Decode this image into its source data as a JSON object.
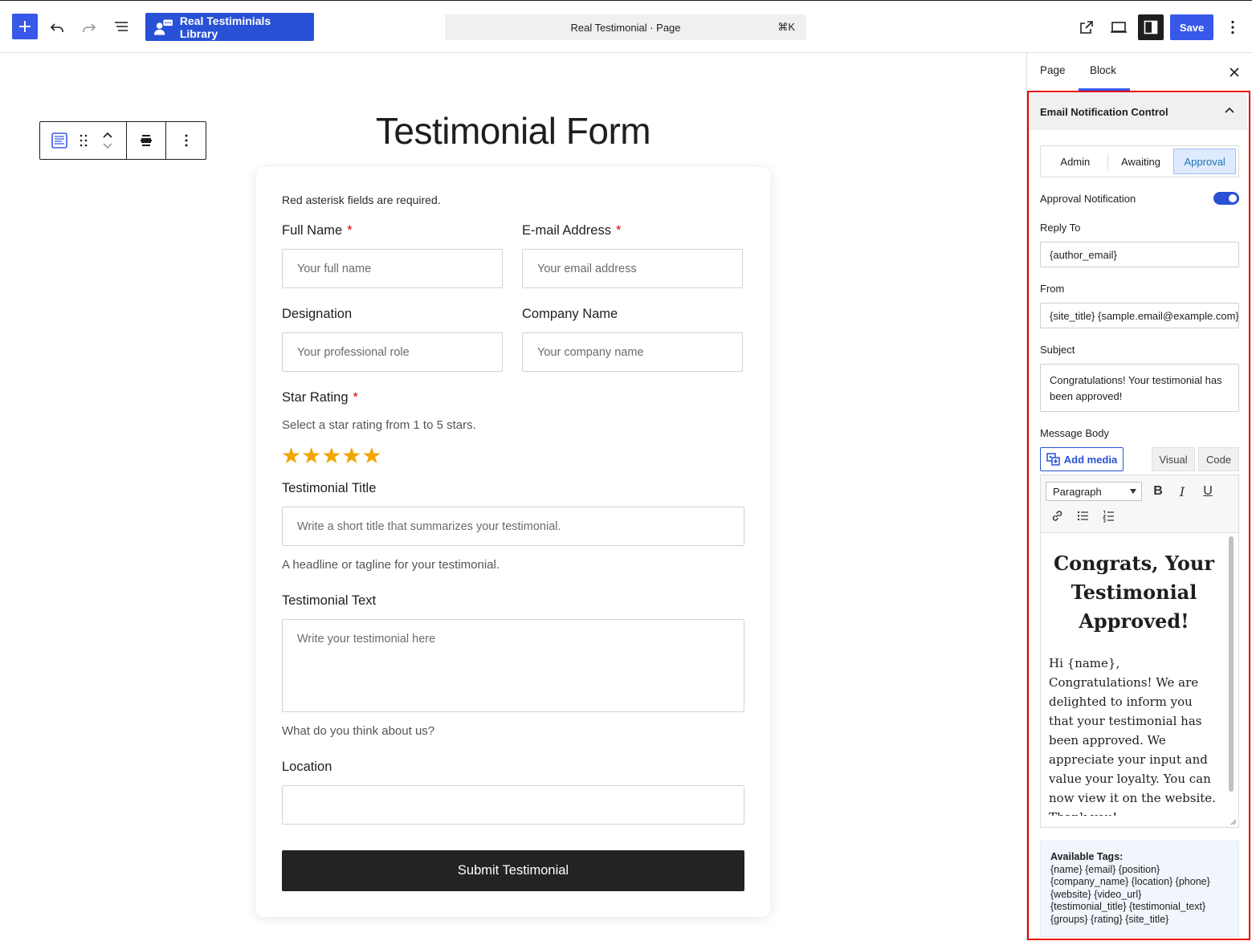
{
  "topbar": {
    "add_icon": "plus-icon",
    "undo_icon": "undo-icon",
    "redo_icon": "redo-icon",
    "list_view_icon": "list-view-icon",
    "library_button": "Real Testiminials Library",
    "document_title": "Real Testimonial · Page",
    "shortcut": "⌘K",
    "view_icon": "external-link-icon",
    "preview_icon": "desktop-preview-icon",
    "settings_icon": "sidebar-toggle-icon",
    "save_label": "Save",
    "options_icon": "more-vertical-icon"
  },
  "canvas": {
    "title": "Testimonial Form",
    "block_toolbar": {
      "block_icon": "form-block-icon",
      "drag_icon": "drag-handle-icon",
      "move_icon": "move-up-down-icon",
      "align_icon": "align-center-icon",
      "more_icon": "more-vertical-icon"
    }
  },
  "form": {
    "required_note": "Red asterisk fields are required.",
    "asterisk": "*",
    "full_name": {
      "label": "Full Name",
      "placeholder": "Your full name"
    },
    "email": {
      "label": "E-mail Address",
      "placeholder": "Your email address"
    },
    "designation": {
      "label": "Designation",
      "placeholder": "Your professional role"
    },
    "company": {
      "label": "Company Name",
      "placeholder": "Your company name"
    },
    "rating": {
      "label": "Star Rating",
      "help": "Select a star rating from 1 to 5 stars.",
      "stars": "★★★★★",
      "value": 5,
      "max": 5
    },
    "title": {
      "label": "Testimonial Title",
      "placeholder": "Write a short title that summarizes your testimonial.",
      "help": "A headline or tagline for your testimonial."
    },
    "text": {
      "label": "Testimonial Text",
      "placeholder": "Write your testimonial here",
      "help": "What do you think about us?"
    },
    "location": {
      "label": "Location",
      "placeholder": ""
    },
    "submit": "Submit Testimonial"
  },
  "sidebar": {
    "tabs": [
      "Page",
      "Block"
    ],
    "active_tab": "Block",
    "close_icon": "close-icon",
    "panel_title": "Email Notification Control",
    "panel_toggle_icon": "chevron-up-icon",
    "segments": [
      "Admin",
      "Awaiting",
      "Approval"
    ],
    "active_segment": "Approval",
    "approval_toggle": {
      "label": "Approval Notification",
      "on": true
    },
    "reply_to": {
      "label": "Reply To",
      "value": "{author_email}"
    },
    "from": {
      "label": "From",
      "value": "{site_title} {sample.email@example.com}"
    },
    "subject": {
      "label": "Subject",
      "value": "Congratulations! Your testimonial has been approved!"
    },
    "message_body": {
      "label": "Message Body",
      "add_media": "Add media",
      "visual": "Visual",
      "code": "Code",
      "format": "Paragraph",
      "bold": "B",
      "italic": "I",
      "underline": "U",
      "heading": "Congrats, Your Testimonial Approved!",
      "body": "Hi {name}, Congratulations! We are delighted to inform you that your testimonial has been approved. We appreciate your input and value your loyalty. You can now view it on the website.",
      "closing": "Thank you!"
    },
    "tags": {
      "heading": "Available Tags:",
      "lines": [
        "{name} {email} {position}",
        "{company_name} {location} {phone}",
        "{website} {video_url}",
        "{testimonial_title} {testimonial_text}",
        "{groups} {rating} {site_title}"
      ]
    }
  },
  "colors": {
    "accent": "#3858e9",
    "library_button": "#2851d6",
    "star": "#f0a500",
    "required": "#dd0000",
    "highlight_outline": "#e60000",
    "submit_bg": "#232323"
  }
}
